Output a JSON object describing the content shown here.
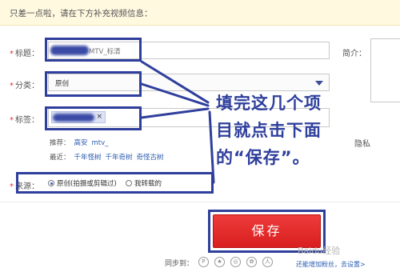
{
  "notice": "只差一点啦，请在下方补充视频信息：",
  "form": {
    "title_label": "标题：",
    "title_value": "MTV_标清",
    "category_label": "分类：",
    "category_value": "原创",
    "tags_label": "标签：",
    "tag_remove": "×",
    "recommend_label": "推荐：",
    "recommend_tags": [
      "高安",
      "mtv_"
    ],
    "recent_label": "最近：",
    "recent_tags": [
      "千年怪树",
      "千年奇树",
      "奇怪古树"
    ],
    "source_label": "来源：",
    "source_options": [
      "原创(拍摄或剪辑过)",
      "我转载的"
    ],
    "source_selected": 0,
    "intro_label": "简介：",
    "privacy_fragment": "隐私"
  },
  "annotation": {
    "lines": [
      "填完这几个项",
      "目就点击下面",
      "的“保存”。"
    ],
    "color": "#2f3f9c"
  },
  "save_label": "保存",
  "footer": {
    "share_label": "同步到：",
    "share_icons": [
      "pengyou-icon",
      "qzone-icon",
      "weibo-icon",
      "tencent-weibo-icon",
      "renren-icon"
    ],
    "settings_link": "还能增加粉丝，去设置>"
  },
  "watermark": "Baidu经验"
}
